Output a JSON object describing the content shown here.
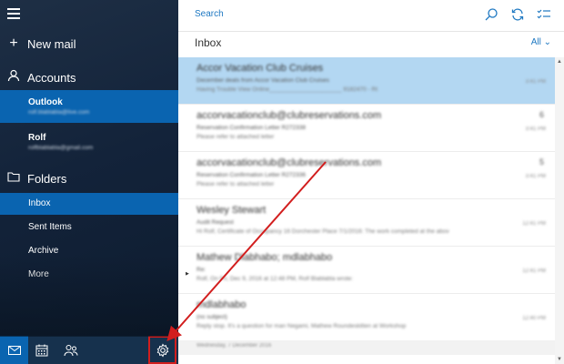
{
  "sidebar": {
    "new_mail": "New mail",
    "accounts_label": "Accounts",
    "accounts": [
      {
        "name": "Outlook",
        "email": "rolf.blablabla@live.com"
      },
      {
        "name": "Rolf",
        "email": "rolfblablabla@gmail.com"
      }
    ],
    "folders_label": "Folders",
    "folders": [
      "Inbox",
      "Sent Items",
      "Archive",
      "More"
    ]
  },
  "topbar": {
    "search_placeholder": "Search"
  },
  "list": {
    "title": "Inbox",
    "filter": "All",
    "items": [
      {
        "sender": "Accor Vacation Club Cruises",
        "subject": "December deals from Accor Vacation Club Cruises",
        "preview": "Having Trouble View Online______________________ 9182470 - Rt",
        "time": "3:41 PM",
        "count": ""
      },
      {
        "sender": "accorvacationclub@clubreservations.com",
        "subject": "Reservation Confirmation Letter R272338",
        "preview": "Please refer to attached letter",
        "time": "3:41 PM",
        "count": "6"
      },
      {
        "sender": "accorvacationclub@clubreservations.com",
        "subject": "Reservation Confirmation Letter R272336",
        "preview": "Please refer to attached letter",
        "time": "3:41 PM",
        "count": "5"
      },
      {
        "sender": "Wesley Stewart",
        "subject": "Audit Request",
        "preview": "Hi Rolf, Certificate of Occupancy 16 Dorchester Place 7/1/2016: The work completed at the abov",
        "time": "12:41 PM",
        "count": ""
      },
      {
        "sender": "Mathew Dlabhabo; mdlabhabo",
        "subject": "Re:",
        "preview": "Rolf, On Fri, Dec 9, 2016 at 12:48 PM, Rolf Blablabla wrote:",
        "time": "12:41 PM",
        "count": ""
      },
      {
        "sender": "mdlabhabo",
        "subject": "(no subject)",
        "preview": "Reply stop. It's a question for man Negami, Mathew Roundeskitten at Workshop",
        "time": "12:40 PM",
        "count": ""
      }
    ],
    "date_separator": "Wednesday, 7 December 2016"
  },
  "colors": {
    "accent": "#0a64b0",
    "link": "#1e78c2",
    "selected_row": "#b3d7f2",
    "annotation": "#d21e1e"
  }
}
